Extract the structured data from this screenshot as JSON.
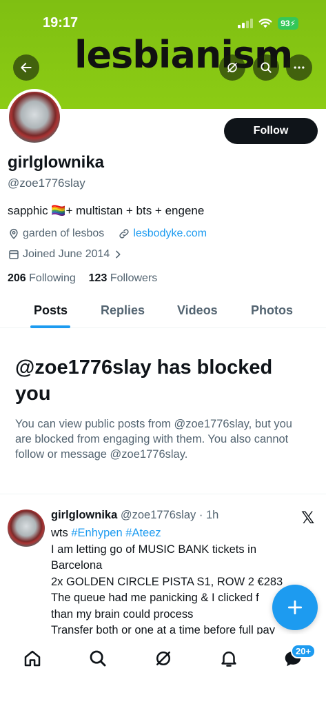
{
  "status_bar": {
    "time": "19:17",
    "battery": "93"
  },
  "banner": {
    "text": "lesbianism"
  },
  "profile": {
    "display_name": "girlglownika",
    "handle": "@zoe1776slay",
    "follow_label": "Follow",
    "bio": "sapphic 🏳️‍🌈+ multistan + bts + engene",
    "location": "garden of lesbos",
    "website": "lesbodyke.com",
    "joined": "Joined June 2014",
    "following_count": "206",
    "following_label": "Following",
    "followers_count": "123",
    "followers_label": "Followers"
  },
  "tabs": [
    {
      "label": "Posts",
      "active": true
    },
    {
      "label": "Replies"
    },
    {
      "label": "Videos"
    },
    {
      "label": "Photos"
    }
  ],
  "blocked": {
    "title": "@zoe1776slay has blocked you",
    "description": "You can view public posts from @zoe1776slay, but you are blocked from engaging with them. You also cannot follow or message @zoe1776slay."
  },
  "tweet": {
    "author_name": "girlglownika",
    "author_handle": "@zoe1776slay",
    "separator": " · ",
    "time": "1h",
    "prefix": "wts",
    "hashtag1": "#Enhypen",
    "hashtag2": "#Ateez",
    "lines": [
      "I am letting go of MUSIC BANK tickets in",
      "Barcelona",
      "2x GOLDEN CIRCLE PISTA S1, ROW 2 €283",
      "The queue had me panicking & I clicked f",
      "than my brain could process",
      "Transfer both or one at a time before full pay"
    ]
  },
  "bottom_nav": {
    "notifications_badge": "20+"
  },
  "colors": {
    "accent": "#1d9bf0",
    "banner": "#8ccc14",
    "text_secondary": "#536471"
  }
}
